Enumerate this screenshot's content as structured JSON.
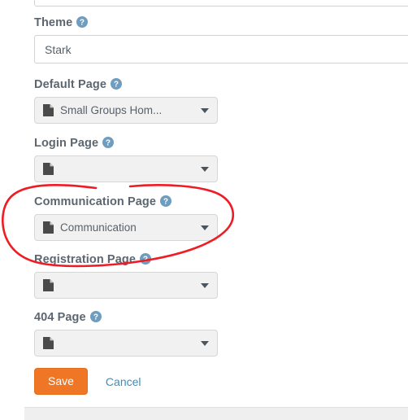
{
  "form": {
    "fields": [
      {
        "name": "theme",
        "label": "Theme",
        "help_icon": "help-circle-icon",
        "control": "text",
        "value": "Stark",
        "placeholder": ""
      },
      {
        "name": "default-page",
        "label": "Default Page",
        "help_icon": "help-circle-icon",
        "control": "page-picker",
        "value": "Small Groups Hom...",
        "icon": "document-icon",
        "caret_icon": "caret-down-icon"
      },
      {
        "name": "login-page",
        "label": "Login Page",
        "help_icon": "help-circle-icon",
        "control": "page-picker",
        "value": "",
        "icon": "document-icon",
        "caret_icon": "caret-down-icon"
      },
      {
        "name": "communication-page",
        "label": "Communication Page",
        "help_icon": "help-circle-icon",
        "control": "page-picker",
        "value": "Communication",
        "icon": "document-icon",
        "caret_icon": "caret-down-icon"
      },
      {
        "name": "registration-page",
        "label": "Registration Page",
        "help_icon": "help-circle-icon",
        "control": "page-picker",
        "value": "",
        "icon": "document-icon",
        "caret_icon": "caret-down-icon"
      },
      {
        "name": "404-page",
        "label": "404 Page",
        "help_icon": "help-circle-icon",
        "control": "page-picker",
        "value": "",
        "icon": "document-icon",
        "caret_icon": "caret-down-icon"
      }
    ]
  },
  "actions": {
    "save_label": "Save",
    "cancel_label": "Cancel"
  },
  "annotation": {
    "name": "red-ellipse-highlight",
    "target": "communication-page",
    "color": "#ee1c24"
  },
  "colors": {
    "save_button": "#ee7624",
    "cancel_link": "#3c8dbc",
    "label_text": "#5c6670",
    "help_icon": "#6f9dc0",
    "picker_background": "#f1f1f1",
    "annotation_red": "#ee1c24"
  }
}
